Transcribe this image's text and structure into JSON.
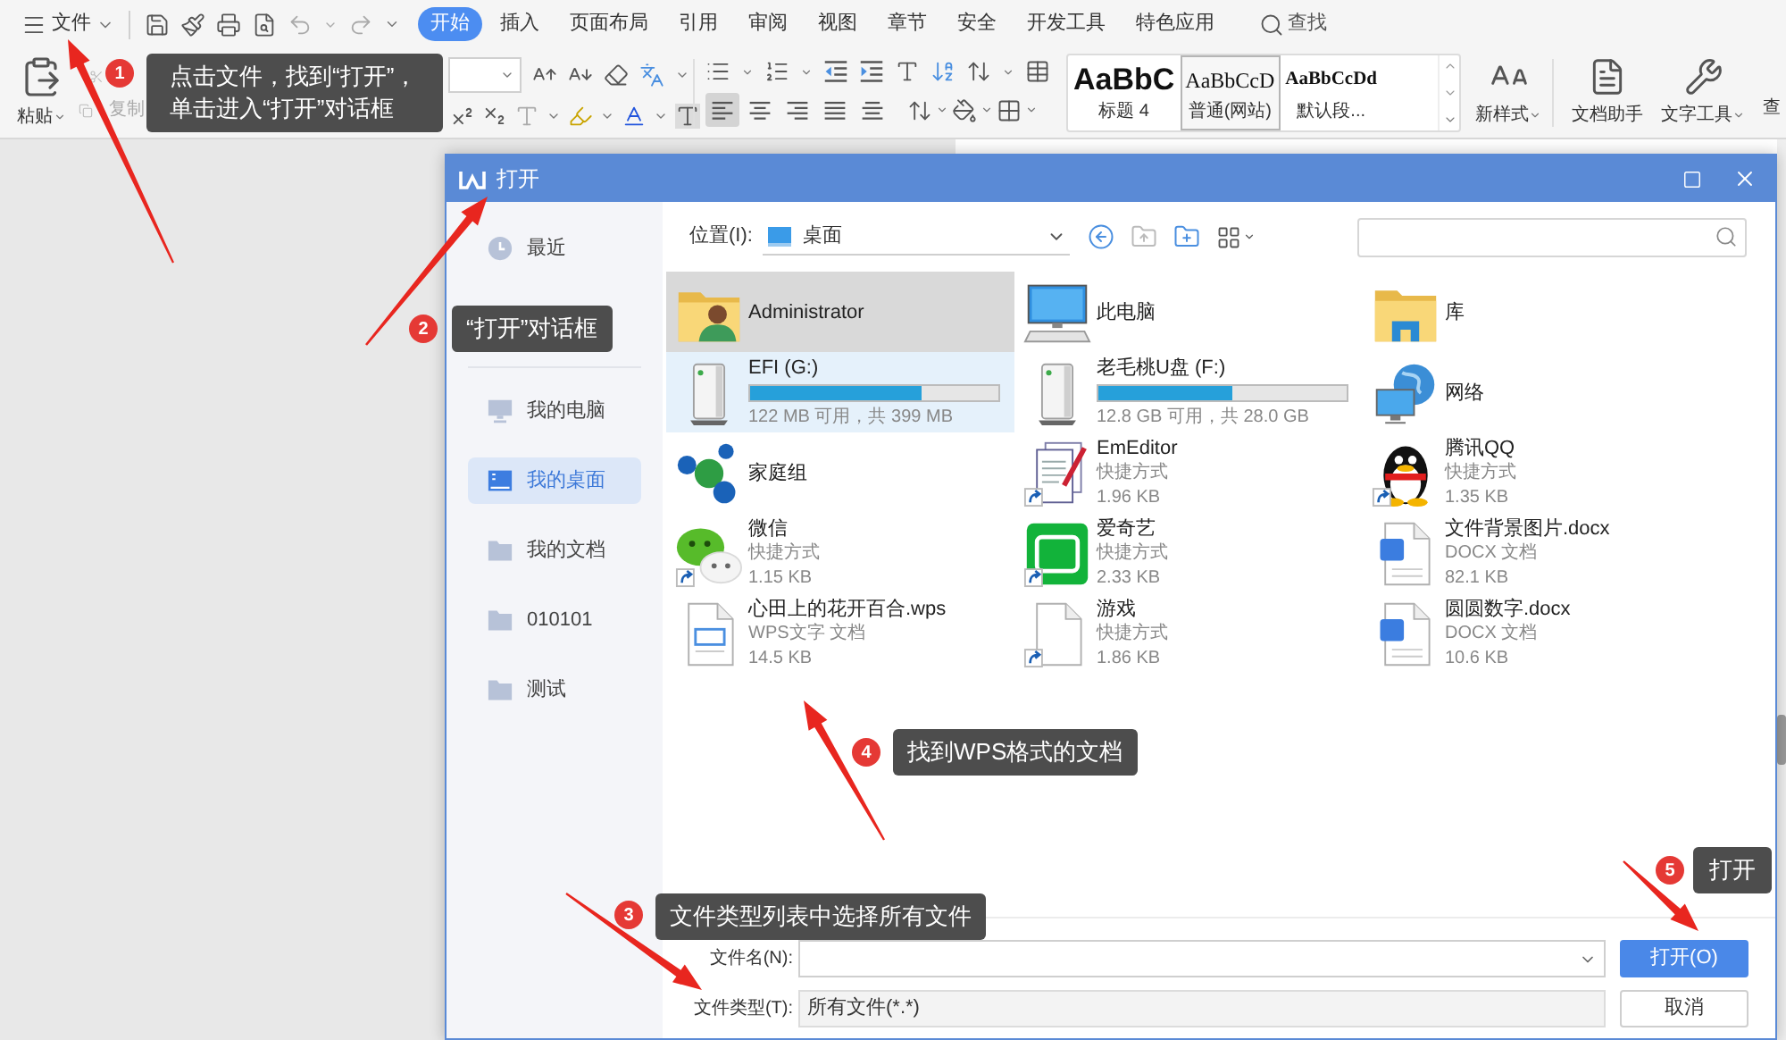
{
  "title_bar": {
    "menu_label": "文件",
    "tabs": [
      {
        "label": "开始",
        "selected": true
      },
      {
        "label": "插入",
        "selected": false
      },
      {
        "label": "页面布局",
        "selected": false
      },
      {
        "label": "引用",
        "selected": false
      },
      {
        "label": "审阅",
        "selected": false
      },
      {
        "label": "视图",
        "selected": false
      },
      {
        "label": "章节",
        "selected": false
      },
      {
        "label": "安全",
        "selected": false
      },
      {
        "label": "开发工具",
        "selected": false
      },
      {
        "label": "特色应用",
        "selected": false
      }
    ],
    "search_label": "查找"
  },
  "ribbon": {
    "paste_label": "粘贴",
    "copy_label": "复制",
    "copy_disabled": true,
    "align_buttons": [
      {
        "kind": "left",
        "selected": true
      },
      {
        "kind": "center",
        "selected": false
      },
      {
        "kind": "right",
        "selected": false
      },
      {
        "kind": "justify",
        "selected": false
      },
      {
        "kind": "distributed",
        "selected": false
      }
    ],
    "styles": [
      {
        "preview": "AaBbC",
        "name": "标题 4",
        "selected": false
      },
      {
        "preview": "AaBbCcD",
        "name": "普通(网站)",
        "selected": true
      },
      {
        "preview": "AaBbCcDd",
        "name": "默认段...",
        "selected": false
      }
    ],
    "tools": [
      {
        "kind": "new-style",
        "label": "新样式"
      },
      {
        "kind": "assistant",
        "label": "文档助手"
      },
      {
        "kind": "text-tools",
        "label": "文字工具"
      }
    ],
    "button_cut_off": "查"
  },
  "dialog": {
    "title": "打开",
    "sidebar": [
      {
        "label": "最近",
        "kind": "recent",
        "selected": false
      },
      {
        "label": "我的电脑",
        "kind": "computer",
        "selected": false
      },
      {
        "label": "我的桌面",
        "kind": "desktop",
        "selected": true
      },
      {
        "label": "我的文档",
        "kind": "folder",
        "selected": false
      },
      {
        "label": "010101",
        "kind": "folder",
        "selected": false
      },
      {
        "label": "测试",
        "kind": "folder",
        "selected": false
      }
    ],
    "location_label": "位置(I):",
    "location_value": "桌面",
    "file_rows": [
      [
        {
          "name": "Administrator",
          "kind": "user-folder",
          "selected": true,
          "hovered": false,
          "shortcut": false
        },
        {
          "name": "此电脑",
          "kind": "computer",
          "selected": false,
          "hovered": false,
          "shortcut": false
        },
        {
          "name": "库",
          "kind": "library",
          "selected": false,
          "hovered": false,
          "shortcut": false
        }
      ],
      [
        {
          "name": "EFI (G:)",
          "kind": "drive",
          "level": 0.69,
          "detail": "122 MB 可用，共 399 MB",
          "selected": false,
          "hovered": true,
          "shortcut": false
        },
        {
          "name": "老毛桃U盘 (F:)",
          "kind": "drive",
          "level": 0.54,
          "detail": "12.8 GB 可用，共 28.0 GB",
          "selected": false,
          "hovered": false,
          "shortcut": false
        },
        {
          "name": "网络",
          "kind": "network",
          "selected": false,
          "hovered": false,
          "shortcut": false
        }
      ],
      [
        {
          "name": "家庭组",
          "kind": "homegroup",
          "selected": false,
          "hovered": false,
          "shortcut": false
        },
        {
          "name": "EmEditor",
          "kind": "editor",
          "type": "快捷方式",
          "size": "1.96 KB",
          "selected": false,
          "hovered": false,
          "shortcut": true
        },
        {
          "name": "腾讯QQ",
          "kind": "penguin",
          "type": "快捷方式",
          "size": "1.35 KB",
          "selected": false,
          "hovered": false,
          "shortcut": true
        }
      ],
      [
        {
          "name": "微信",
          "kind": "chat",
          "type": "快捷方式",
          "size": "1.15 KB",
          "selected": false,
          "hovered": false,
          "shortcut": true
        },
        {
          "name": "爱奇艺",
          "kind": "video",
          "type": "快捷方式",
          "size": "2.33 KB",
          "selected": false,
          "hovered": false,
          "shortcut": true
        },
        {
          "name": "文件背景图片.docx",
          "kind": "docx",
          "type": "DOCX 文档",
          "size": "82.1 KB",
          "selected": false,
          "hovered": false,
          "shortcut": false
        }
      ],
      [
        {
          "name": "心田上的花开百合.wps",
          "kind": "wps",
          "type": "WPS文字 文档",
          "size": "14.5 KB",
          "selected": false,
          "hovered": false,
          "shortcut": false
        },
        {
          "name": "游戏",
          "kind": "blank",
          "type": "快捷方式",
          "size": "1.86 KB",
          "selected": false,
          "hovered": false,
          "shortcut": true
        },
        {
          "name": "圆圆数字.docx",
          "kind": "docx",
          "type": "DOCX 文档",
          "size": "10.6 KB",
          "selected": false,
          "hovered": false,
          "shortcut": false
        }
      ]
    ],
    "filename_label": "文件名(N):",
    "filetype_label": "文件类型(T):",
    "filetype_value": "所有文件(*.*)",
    "buttons": [
      {
        "label": "打开(O)",
        "kind": "primary"
      },
      {
        "label": "取消",
        "kind": "secondary"
      }
    ]
  },
  "annotations": [
    {
      "number": "1",
      "text": "点击文件，找到“打开”，单击进入“打开”对话框"
    },
    {
      "number": "2",
      "text": "“打开”对话框"
    },
    {
      "number": "3",
      "text": "文件类型列表中选择所有文件"
    },
    {
      "number": "4",
      "text": "找到WPS格式的文档"
    },
    {
      "number": "5",
      "text": "打开"
    }
  ]
}
